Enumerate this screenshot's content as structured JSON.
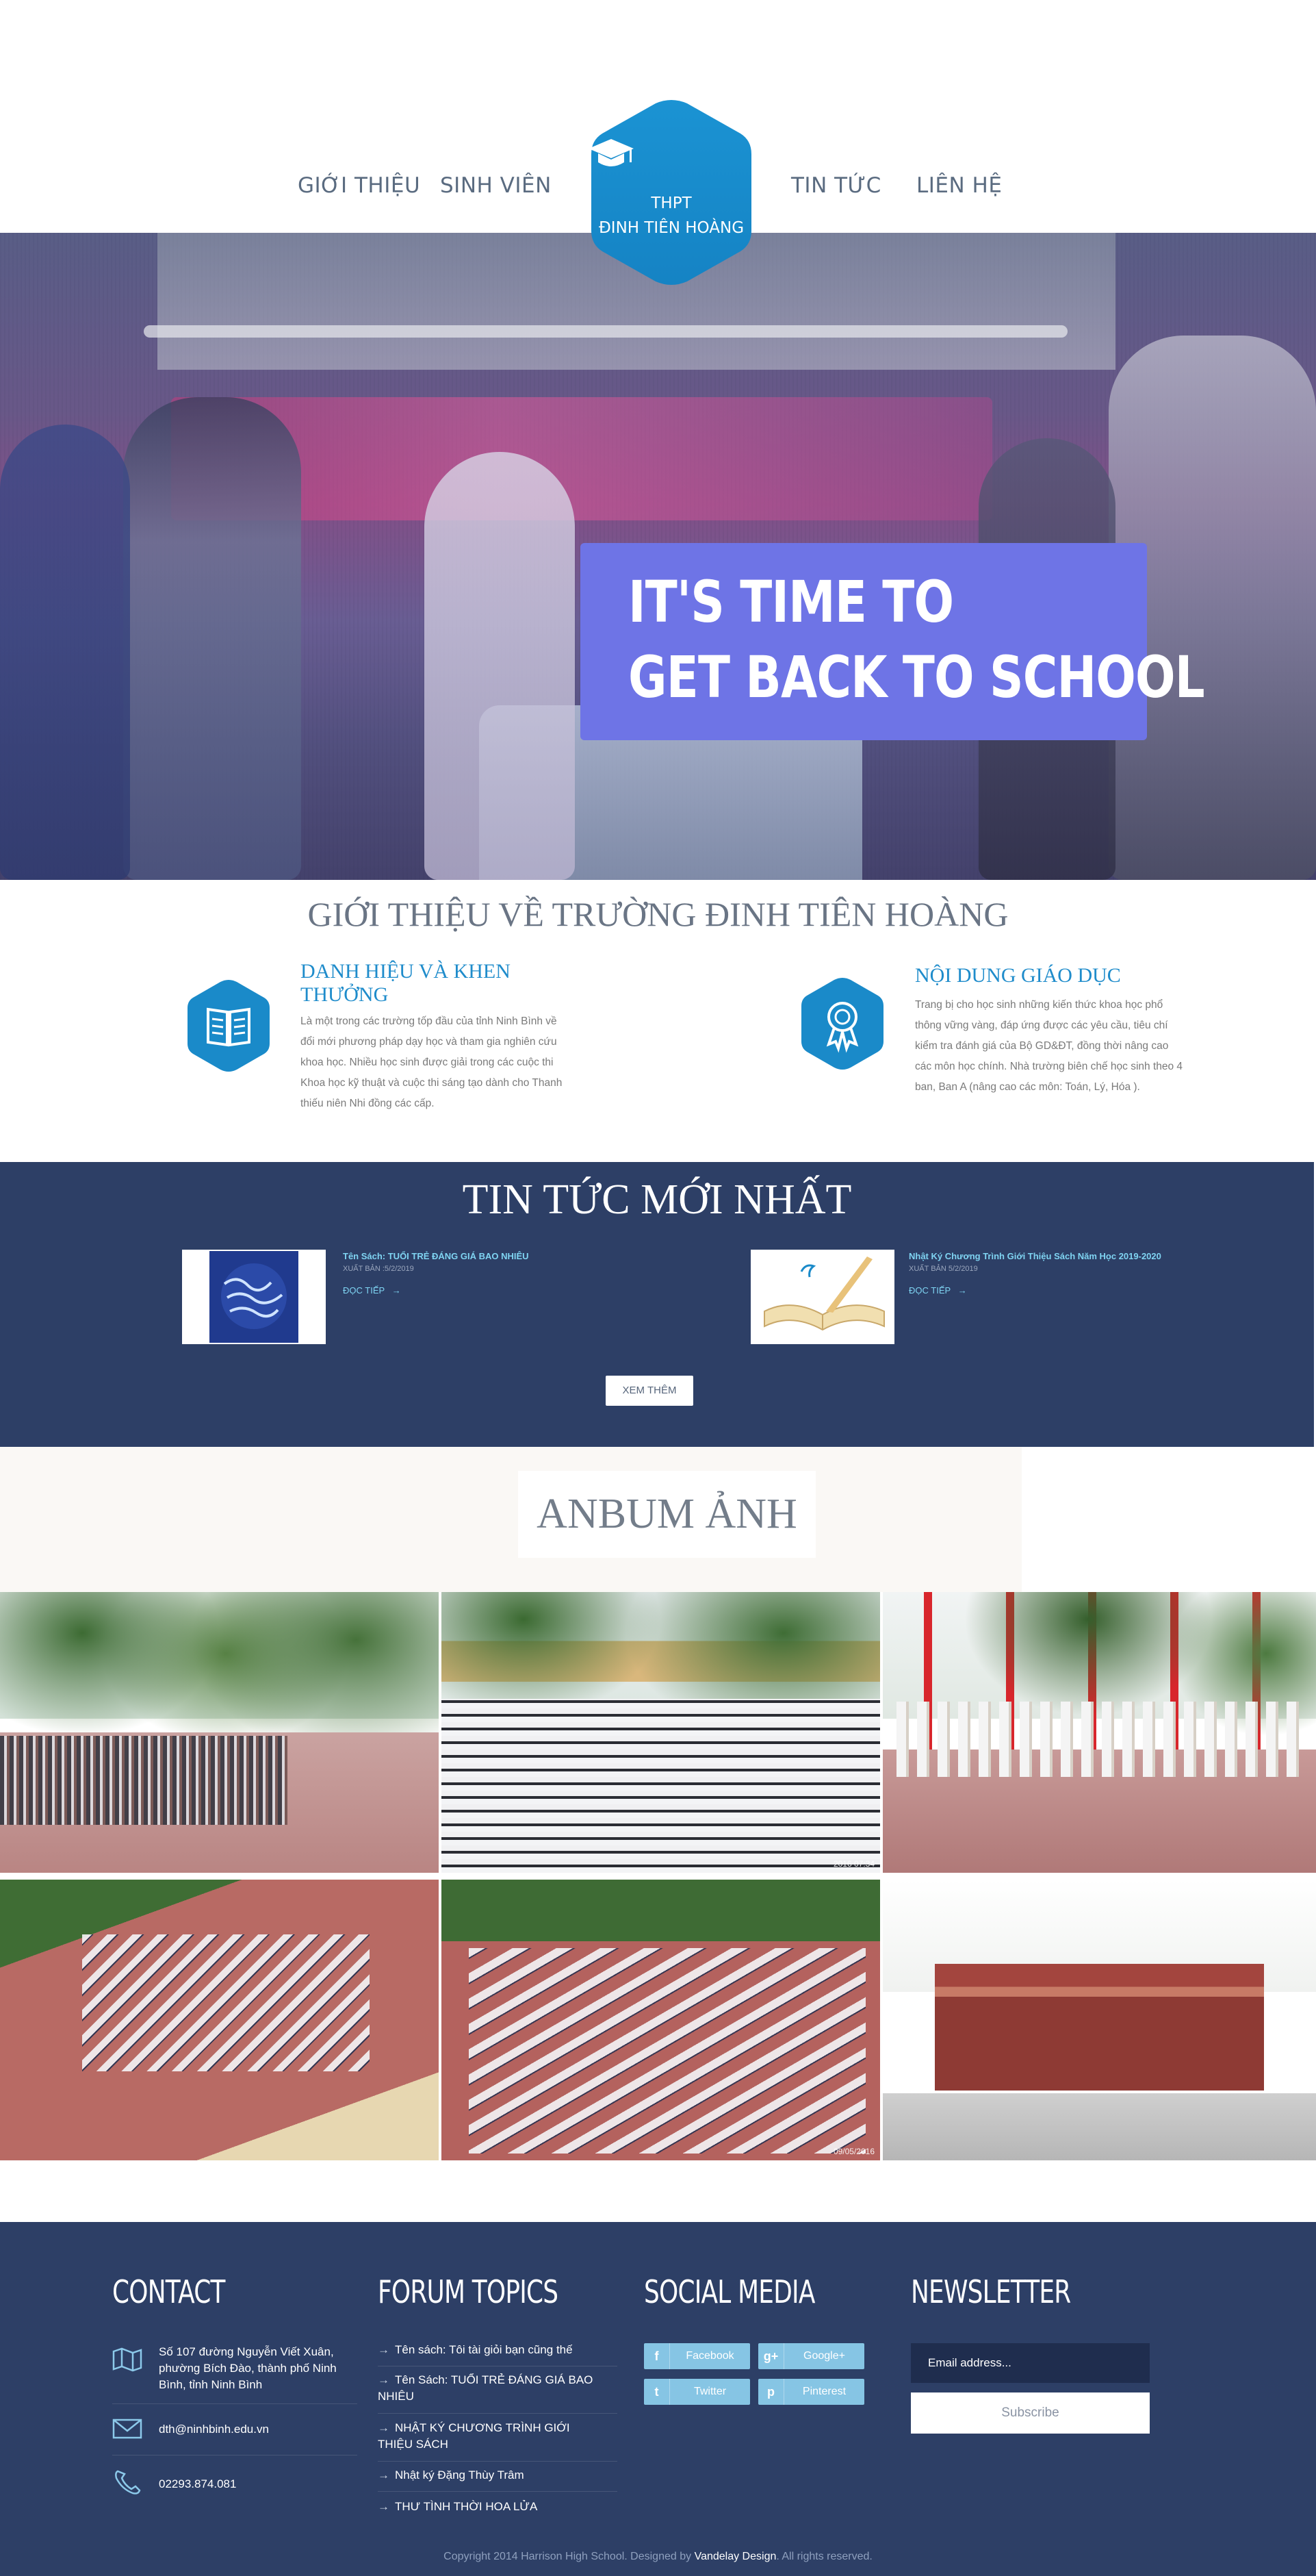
{
  "nav": {
    "items": [
      "GIỚI THIỆU",
      "SINH VIÊN",
      "TIN TỨC",
      "LIÊN HỆ"
    ],
    "logo_line1": "THPT",
    "logo_line2": "ĐINH TIÊN HOÀNG",
    "logo_icon": "graduation-cap-icon"
  },
  "hero": {
    "line1": "IT'S TIME TO",
    "line2": "GET BACK TO SCHOOL"
  },
  "about": {
    "title": "GIỚI THIỆU VỀ TRƯỜNG ĐINH TIÊN HOÀNG",
    "left": {
      "heading_line1": "DANH HIỆU VÀ KHEN",
      "heading_line2": "THƯỞNG",
      "icon": "book-icon",
      "lines": [
        "Là một trong các trường tốp đầu của tỉnh Ninh Bình về",
        "đổi mới phương pháp dạy học và tham gia nghiên cứu",
        "khoa học. Nhiều học sinh được giải trong các cuộc thi",
        "Khoa học kỹ thuật và cuộc thi sáng tạo dành cho Thanh",
        "thiếu niên Nhi đồng các cấp."
      ]
    },
    "right": {
      "heading": "NỘI DUNG GIÁO DỤC",
      "icon": "award-ribbon-icon",
      "lines": [
        "Trang bị cho học sinh những kiến thức khoa học phổ",
        "thông vững vàng, đáp ứng được các yêu cầu, tiêu chí",
        "kiểm tra đánh giá của Bộ GD&ĐT, đồng thời nâng cao",
        "các môn học chính. Nhà trường biên chế học sinh theo 4",
        "ban, Ban A (nâng cao các môn: Toán, Lý, Hóa )."
      ]
    }
  },
  "news": {
    "title": "TIN TỨC MỚI NHẤT",
    "items": [
      {
        "title": "Tên Sách: TUỔI TRẺ ĐÁNG GIÁ BAO NHIÊU",
        "date": "XUẤT BẢN :5/2/2019",
        "more": "ĐỌC TIẾP"
      },
      {
        "title": "Nhật Ký Chương Trình Giới Thiệu Sách Năm Học 2019-2020",
        "date": "XUẤT BẢN 5/2/2019",
        "more": "ĐỌC TIẾP"
      }
    ],
    "more_button": "XEM THÊM"
  },
  "album": {
    "title": "ANBUM ẢNH",
    "stamps": [
      "",
      "2016 07:34",
      "",
      "",
      "09/05/2016",
      ""
    ]
  },
  "footer": {
    "contact": {
      "heading": "CONTACT",
      "address_lines": [
        "Số 107 đường Nguyễn Viết Xuân,",
        "phường Bích Đào, thành phố Ninh",
        "Bình, tỉnh Ninh Bình"
      ],
      "email": "dth@ninhbinh.edu.vn",
      "phone": "02293.874.081"
    },
    "forum": {
      "heading": "FORUM TOPICS",
      "topics": [
        [
          "Tên sách: Tôi tài giỏi bạn cũng thế"
        ],
        [
          "Tên Sách: TUỔI TRẺ ĐÁNG GIÁ BAO",
          "NHIÊU"
        ],
        [
          "NHẬT KÝ CHƯƠNG TRÌNH GIỚI",
          "THIỆU SÁCH"
        ],
        [
          "Nhật ký Đặng Thùy Trâm"
        ],
        [
          "THƯ TÌNH THỜI HOA LỬA"
        ]
      ]
    },
    "social": {
      "heading": "SOCIAL MEDIA",
      "buttons": [
        {
          "label": "Facebook",
          "icon": "f"
        },
        {
          "label": "Google+",
          "icon": "g+"
        },
        {
          "label": "Twitter",
          "icon": "t"
        },
        {
          "label": "Pinterest",
          "icon": "p"
        }
      ]
    },
    "newsletter": {
      "heading": "NEWSLETTER",
      "placeholder": "Email address...",
      "button": "Subscribe"
    },
    "copyright": {
      "prefix": "Copyright 2014 Harrison High School. Designed by",
      "brand": "Vandelay Design",
      "suffix": ". All rights reserved."
    }
  },
  "colors": {
    "brand_blue": "#1a8ac9",
    "navy": "#2d3f66",
    "hero_box": "#6e74e6",
    "link_cyan": "#7fd4f2"
  }
}
